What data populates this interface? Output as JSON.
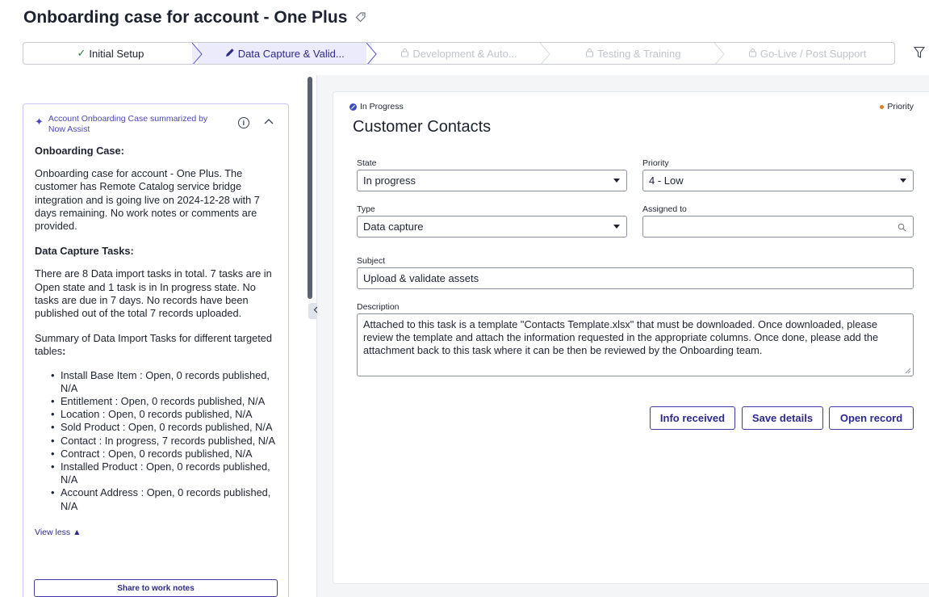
{
  "header": {
    "title": "Onboarding case for account - One Plus",
    "tag_icon": "tag-icon"
  },
  "stages": [
    {
      "label": "Initial Setup",
      "state": "done",
      "icon": "check-icon"
    },
    {
      "label": "Data Capture & Valid...",
      "state": "active",
      "icon": "pencil-icon"
    },
    {
      "label": "Development & Auto...",
      "state": "locked",
      "icon": "lock-icon"
    },
    {
      "label": "Testing & Training",
      "state": "locked",
      "icon": "lock-icon"
    },
    {
      "label": "Go-Live / Post Support",
      "state": "locked",
      "icon": "lock-icon"
    }
  ],
  "summary": {
    "header": "Account Onboarding Case summarized by Now Assist",
    "section1_title": "Onboarding Case:",
    "section1_text": "Onboarding case for account - One Plus. The customer has Remote Catalog service bridge integration and is going live on 2024-12-28 with 7 days remaining. No work notes or comments are provided.",
    "section2_title": "Data Capture Tasks:",
    "section2_text": "There are 8 Data import tasks in total. 7 tasks are in Open state and 1 task is in In progress state. No tasks are due in 7 days. No records have been published out of the total 7 records uploaded.",
    "section3_lead": "Summary of Data Import Tasks for different targeted tables",
    "section3_colon": ":",
    "items": [
      "Install Base Item : Open, 0 records published, N/A",
      "Entitlement : Open, 0 records published, N/A",
      "Location : Open, 0 records published, N/A",
      "Sold Product : Open, 0 records published, N/A",
      "Contact : In progress, 7 records published, N/A",
      "Contract : Open, 0 records published, N/A",
      "Installed Product : Open, 0 records published, N/A",
      "Account Address : Open, 0 records published, N/A"
    ],
    "view_less": "View less",
    "share_button": "Share to work notes"
  },
  "task": {
    "status": "In Progress",
    "priority_tag": "Priority",
    "title": "Customer Contacts",
    "state_label": "State",
    "state_value": "In progress",
    "priority_label": "Priority",
    "priority_value": "4 - Low",
    "type_label": "Type",
    "type_value": "Data capture",
    "assigned_label": "Assigned to",
    "assigned_value": "",
    "subject_label": "Subject",
    "subject_value": "Upload & validate assets",
    "description_label": "Description",
    "description_value": "Attached to this task is a template \"Contacts Template.xlsx\" that must be downloaded. Once downloaded, please review the template and attach the information requested in the appropriate columns. Once done, please add the attachment back to this task where it can be then be reviewed by the Onboarding team.",
    "buttons": {
      "info_received": "Info received",
      "save_details": "Save details",
      "open_record": "Open record"
    }
  },
  "colors": {
    "accent": "#3e3aa8",
    "active_stage_bg": "#ecebfc",
    "status_blue": "#3b4fc4",
    "priority_orange": "#e07b24"
  }
}
